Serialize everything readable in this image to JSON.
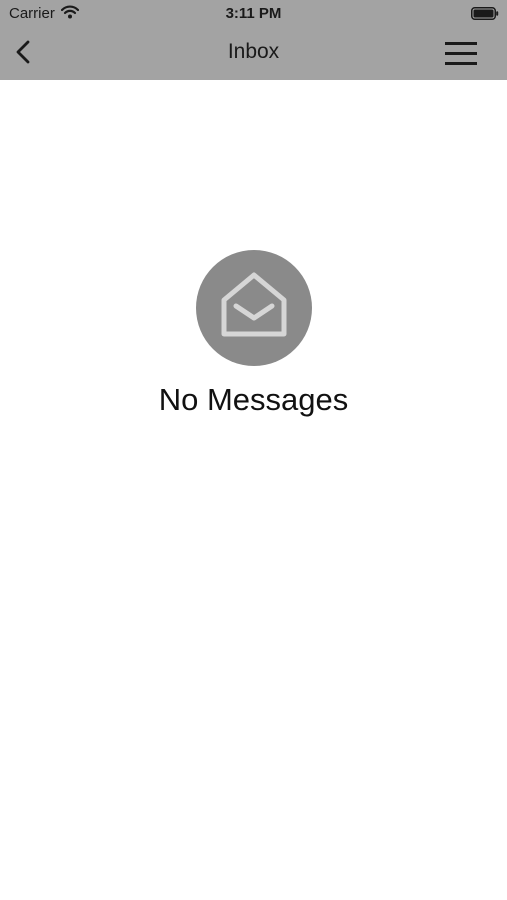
{
  "status_bar": {
    "carrier": "Carrier",
    "time": "3:11 PM",
    "wifi_icon": "wifi-icon",
    "battery_icon": "battery-icon"
  },
  "nav_bar": {
    "title": "Inbox",
    "back_icon": "chevron-left-icon",
    "menu_icon": "hamburger-menu-icon",
    "background_color": "#a3a3a3"
  },
  "empty_state": {
    "icon": "open-envelope-icon",
    "message": "No Messages",
    "icon_background": "#8a8a8a"
  }
}
